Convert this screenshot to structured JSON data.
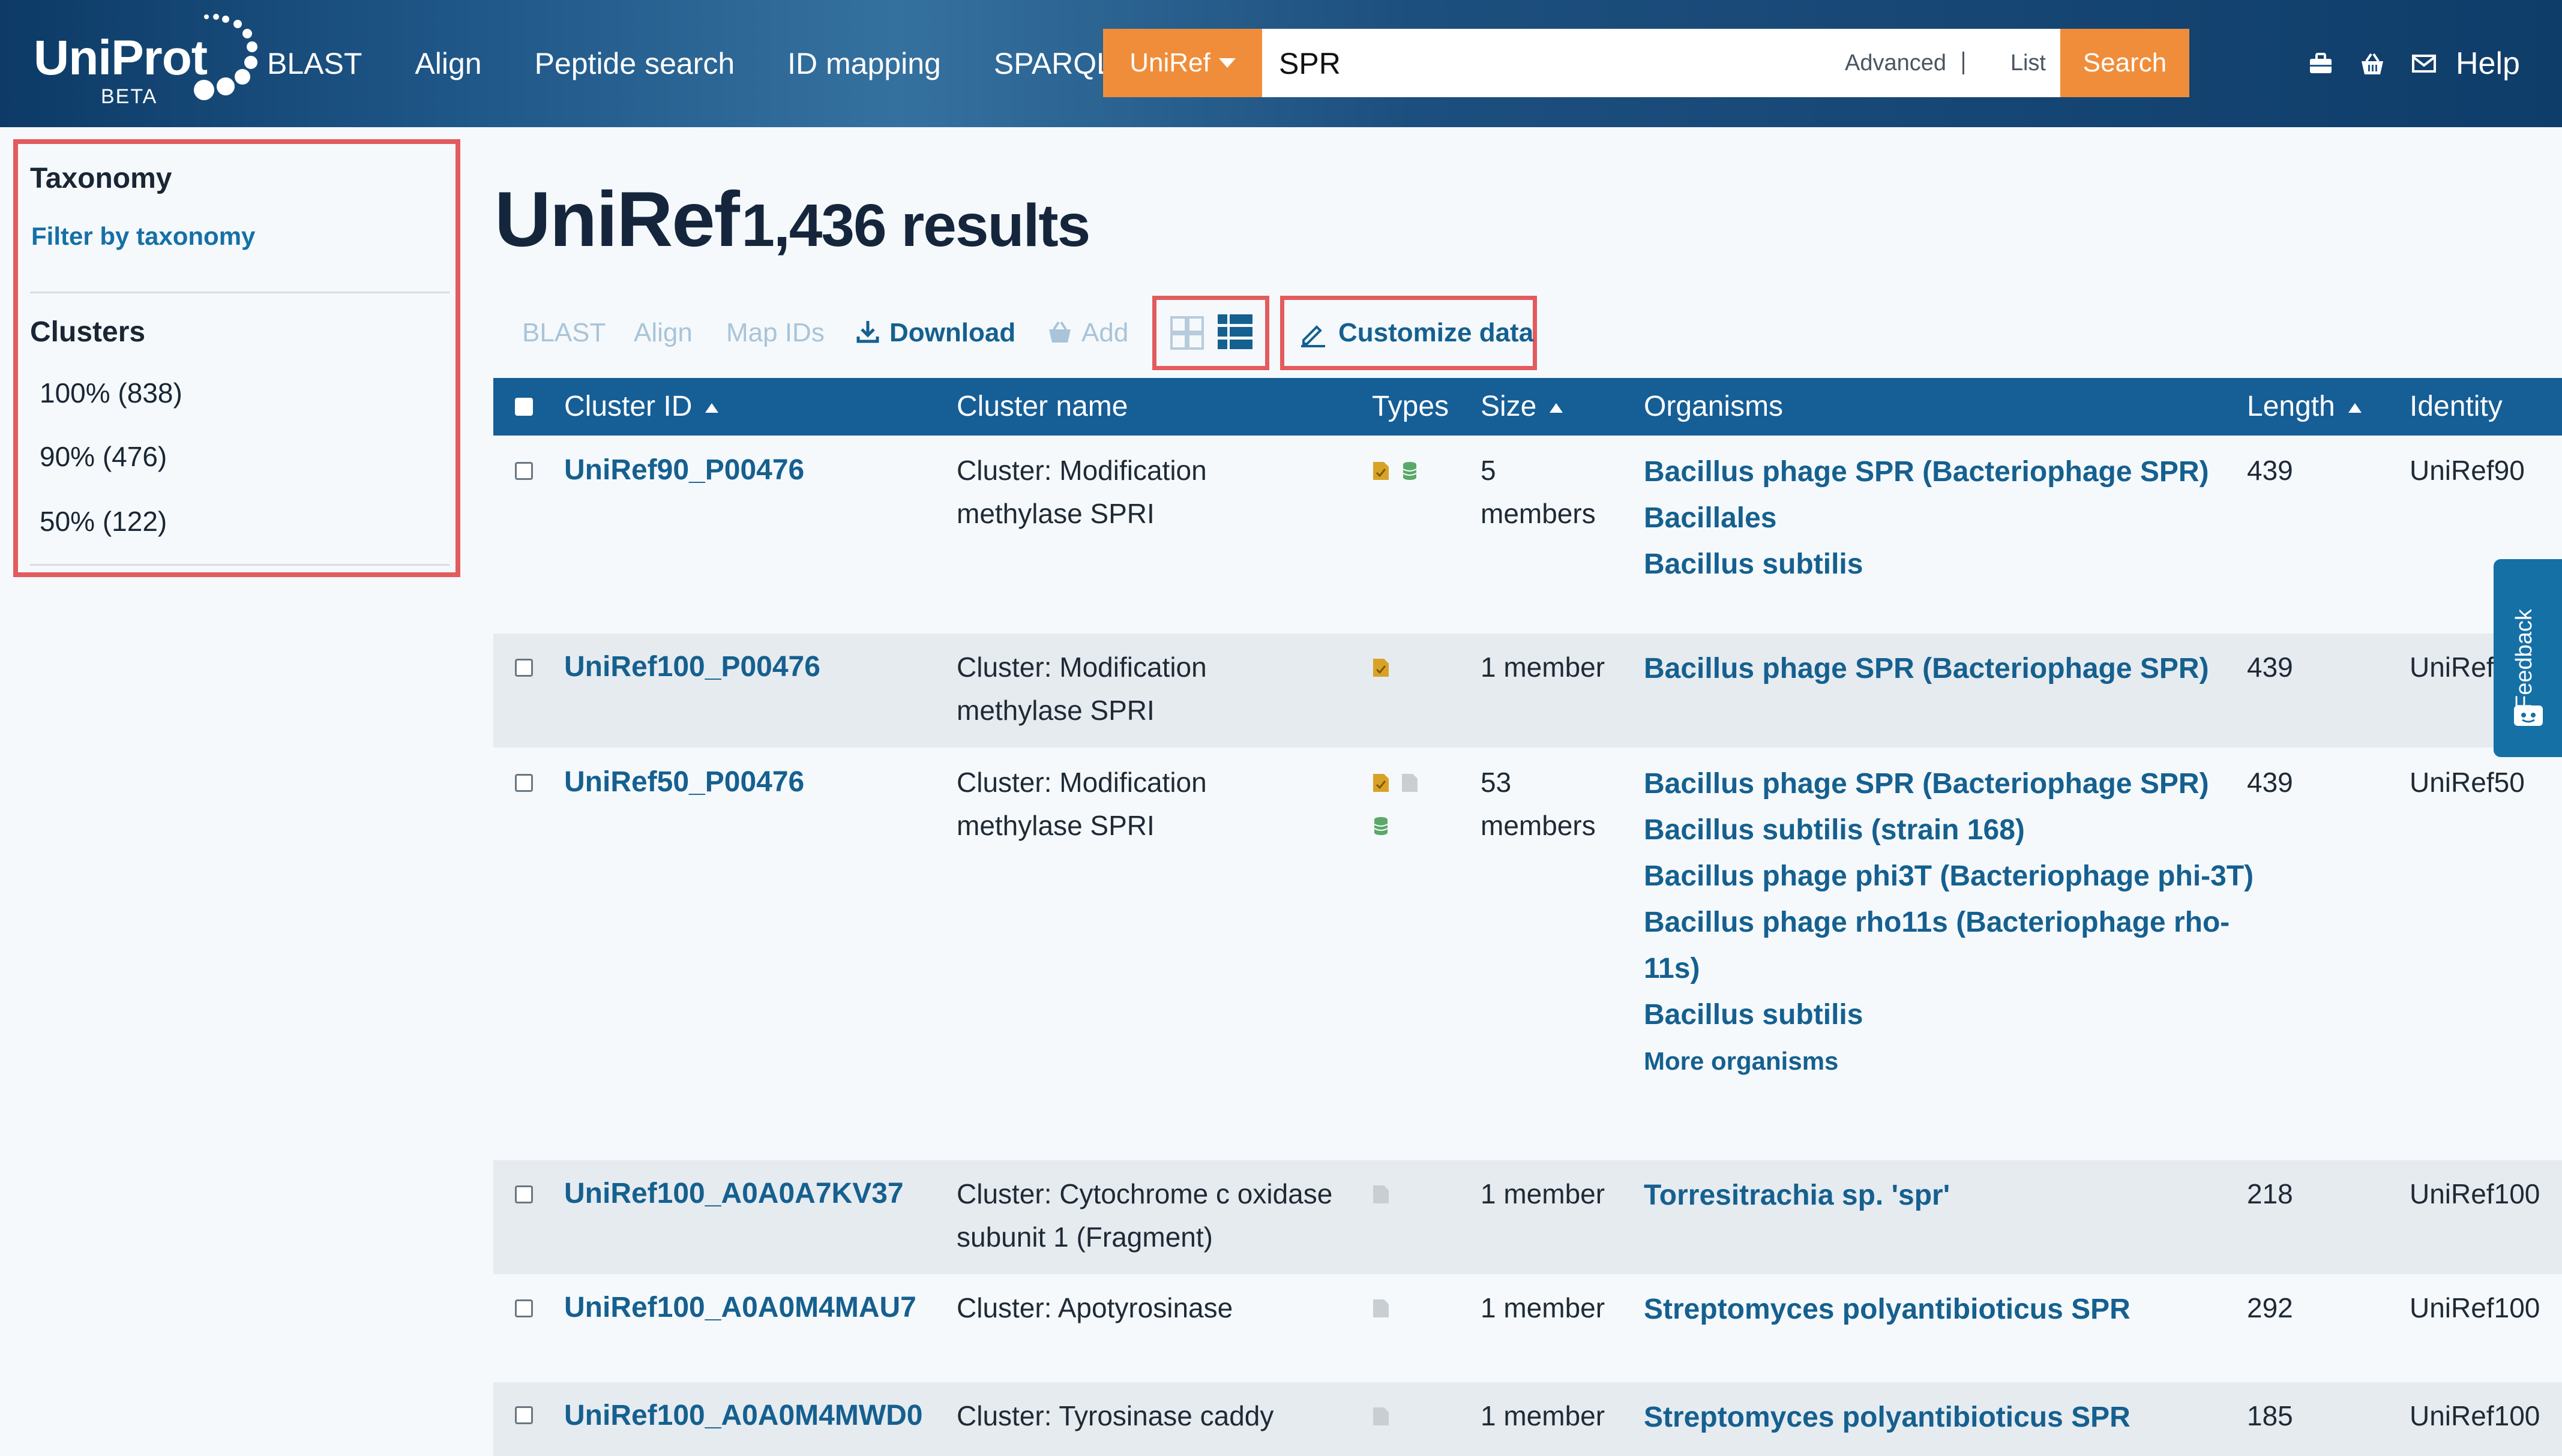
{
  "header": {
    "logo_text": "UniProt",
    "logo_badge": "BETA",
    "nav": [
      "BLAST",
      "Align",
      "Peptide search",
      "ID mapping",
      "SPARQL"
    ],
    "db_select": "UniRef",
    "search_value": "SPR",
    "advanced_label": "Advanced",
    "list_label": "List",
    "search_button": "Search",
    "help_label": "Help",
    "icons": [
      "toolbox-icon",
      "basket-icon",
      "envelope-icon"
    ]
  },
  "sidebar": {
    "taxonomy_heading": "Taxonomy",
    "taxonomy_link": "Filter by taxonomy",
    "clusters_heading": "Clusters",
    "clusters": [
      "100% (838)",
      "90% (476)",
      "50% (122)"
    ]
  },
  "results": {
    "title": "UniRef",
    "count_text": "1,436 results"
  },
  "toolbar": {
    "blast": "BLAST",
    "align": "Align",
    "map_ids": "Map IDs",
    "download": "Download",
    "add": "Add",
    "customize": "Customize data"
  },
  "table": {
    "columns": [
      "Cluster ID",
      "Cluster name",
      "Types",
      "Size",
      "Organisms",
      "Length",
      "Identity"
    ],
    "rows": [
      {
        "id": "UniRef90_P00476",
        "name": [
          "Cluster: Modification",
          "methylase SPRI"
        ],
        "size": [
          "5",
          "members"
        ],
        "organisms": [
          "Bacillus phage SPR (Bacteriophage SPR)",
          "Bacillales",
          "Bacillus subtilis"
        ],
        "length": "439",
        "identity": "UniRef90"
      },
      {
        "id": "UniRef100_P00476",
        "name": [
          "Cluster: Modification",
          "methylase SPRI"
        ],
        "size": [
          "1 member"
        ],
        "organisms": [
          "Bacillus phage SPR (Bacteriophage SPR)"
        ],
        "length": "439",
        "identity": "UniRef"
      },
      {
        "id": "UniRef50_P00476",
        "name": [
          "Cluster: Modification",
          "methylase SPRI"
        ],
        "size": [
          "53",
          "members"
        ],
        "organisms": [
          "Bacillus phage SPR (Bacteriophage SPR)",
          "Bacillus subtilis (strain 168)",
          "Bacillus phage phi3T (Bacteriophage phi-3T)",
          "Bacillus phage rho11s (Bacteriophage rho-",
          "11s)",
          "Bacillus subtilis"
        ],
        "more": "More organisms",
        "length": "439",
        "identity": "UniRef50"
      },
      {
        "id": "UniRef100_A0A0A7KV37",
        "name": [
          "Cluster: Cytochrome c oxidase",
          "subunit 1 (Fragment)"
        ],
        "size": [
          "1 member"
        ],
        "organisms": [
          "Torresitrachia sp. 'spr'"
        ],
        "length": "218",
        "identity": "UniRef100"
      },
      {
        "id": "UniRef100_A0A0M4MAU7",
        "name": [
          "Cluster: Apotyrosinase"
        ],
        "size": [
          "1 member"
        ],
        "organisms": [
          "Streptomyces polyantibioticus SPR"
        ],
        "length": "292",
        "identity": "UniRef100"
      },
      {
        "id": "UniRef100_A0A0M4MWD0",
        "name": [
          "Cluster: Tyrosinase caddy"
        ],
        "size": [
          "1 member"
        ],
        "organisms": [
          "Streptomyces polyantibioticus SPR"
        ],
        "length": "185",
        "identity": "UniRef100"
      }
    ]
  },
  "feedback_label": "Feedback",
  "colors": {
    "header_dark": "#0d3a66",
    "accent_orange": "#f08d3a",
    "table_header": "#165e96",
    "link": "#15608f",
    "highlight_box": "#e25b5e"
  }
}
